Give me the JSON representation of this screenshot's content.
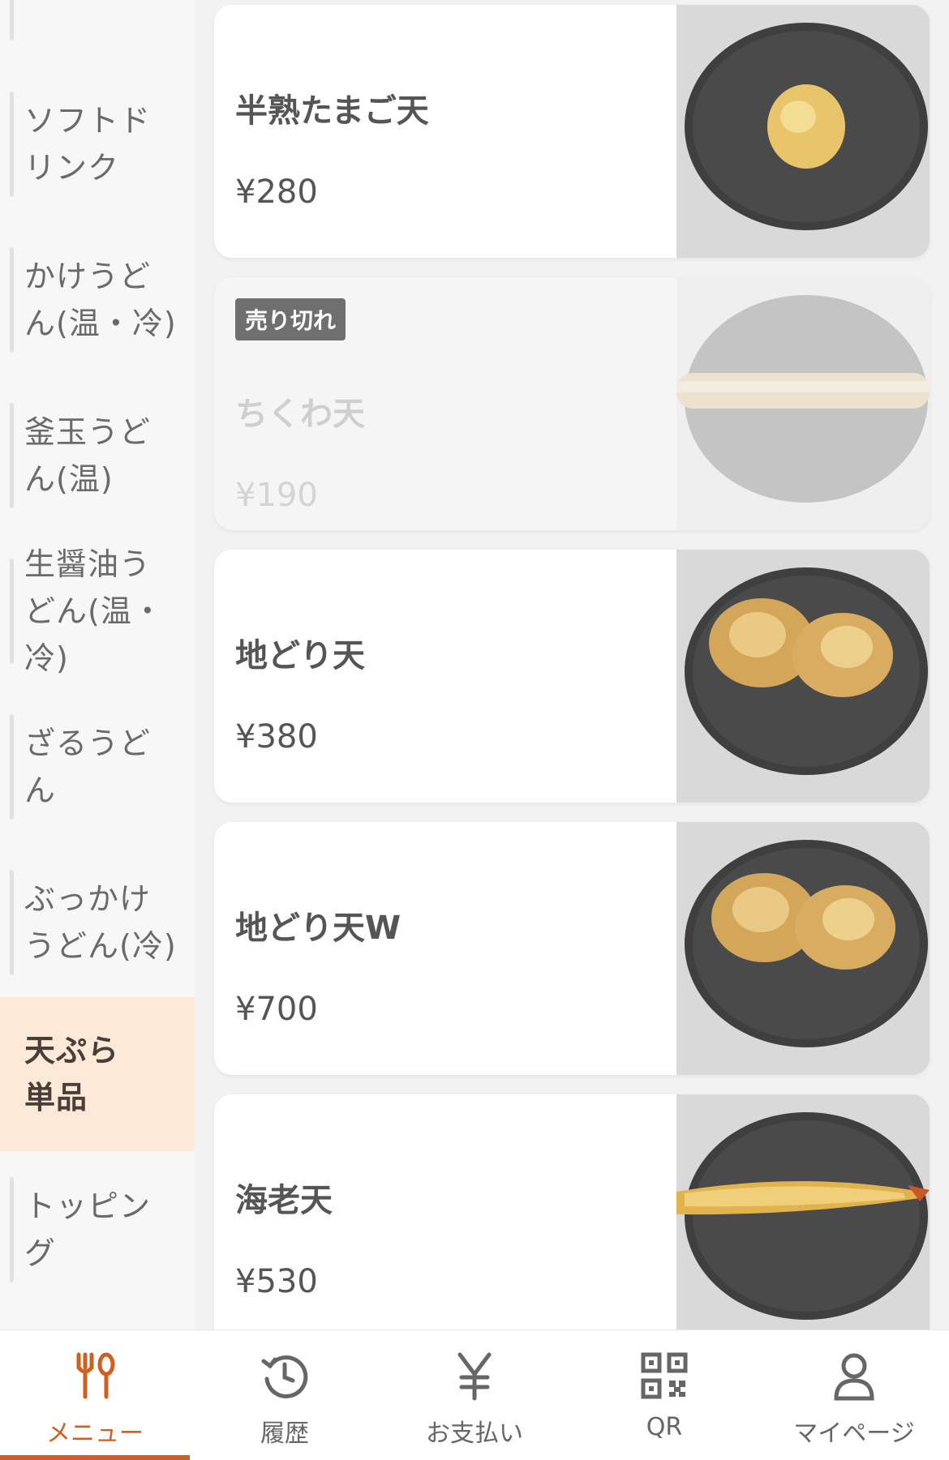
{
  "sidebar": {
    "categories": [
      {
        "label": ""
      },
      {
        "label": "ソフトドリンク"
      },
      {
        "label": "かけうどん(温・冷)"
      },
      {
        "label": "釜玉うどん(温)"
      },
      {
        "label": "生醤油うどん(温・冷)"
      },
      {
        "label": "ざるうどん"
      },
      {
        "label": "ぶっかけうどん(冷)"
      },
      {
        "label": "天ぷら　単品"
      },
      {
        "label": "トッピング"
      }
    ],
    "active_index": 7
  },
  "items": [
    {
      "name": "半熟たまご天",
      "price": "¥280",
      "photo": "egg-tempura"
    },
    {
      "name": "ちくわ天",
      "price": "¥190",
      "photo": "chikuwa-tempura",
      "badge": "売り切れ"
    },
    {
      "name": "地どり天",
      "price": "¥380",
      "photo": "chicken-tempura"
    },
    {
      "name": "地どり天W",
      "price": "¥700",
      "photo": "chicken-tempura"
    },
    {
      "name": "海老天",
      "price": "¥530",
      "photo": "shrimp-tempura"
    }
  ],
  "bottom_nav": [
    {
      "label": "メニュー",
      "icon": "fork-spoon-icon",
      "active": true
    },
    {
      "label": "履歴",
      "icon": "history-icon"
    },
    {
      "label": "お支払い",
      "icon": "yen-icon"
    },
    {
      "label": "QR",
      "icon": "qr-code-icon"
    },
    {
      "label": "マイページ",
      "icon": "person-icon"
    }
  ],
  "colors": {
    "accent": "#d06020",
    "active_category_bg": "#fde9d8"
  }
}
